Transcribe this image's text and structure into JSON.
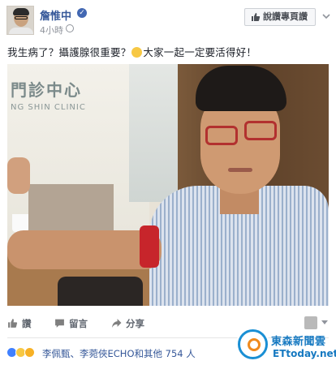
{
  "post": {
    "author": "詹惟中",
    "time": "4小時",
    "like_page_label": "說讚專頁讚",
    "text_part1": "我生病了？攝護腺很重要？",
    "text_part2": "大家一起一定要活得好！",
    "photo": {
      "sign_line1": "門診中心",
      "sign_line2": "NG SHIN CLINIC"
    }
  },
  "actions": {
    "like": "讚",
    "comment": "留言",
    "share": "分享"
  },
  "reactions": {
    "names": "李佩甄、李菀俠ECHO",
    "others": "和其他 754 人"
  },
  "watermark": {
    "name": "東森新聞雲",
    "sub": "ETtoday.net"
  },
  "colors": {
    "link": "#365899",
    "brand_blue": "#4267b2",
    "watermark_blue": "#1679c1",
    "watermark_orange": "#f08a1d"
  }
}
